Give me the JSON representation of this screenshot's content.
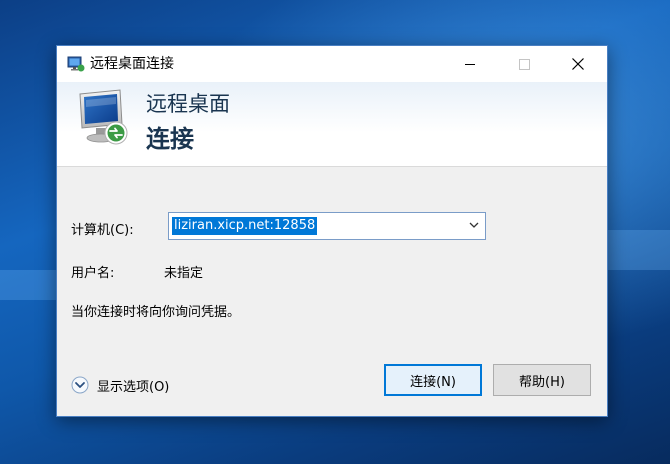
{
  "window": {
    "title": "远程桌面连接",
    "icon": "remote-desktop-icon"
  },
  "banner": {
    "line1": "远程桌面",
    "line2": "连接"
  },
  "form": {
    "computer_label": "计算机(C):",
    "computer_value": "liziran.xicp.net:12858",
    "username_label": "用户名:",
    "username_value": "未指定",
    "note": "当你连接时将向你询问凭据。"
  },
  "footer": {
    "show_options_label": "显示选项(O)",
    "connect_button": "连接(N)",
    "help_button": "帮助(H)"
  },
  "colors": {
    "accent": "#0078d7",
    "window_bg": "#f0f0f0",
    "banner_text": "#1a3550"
  }
}
